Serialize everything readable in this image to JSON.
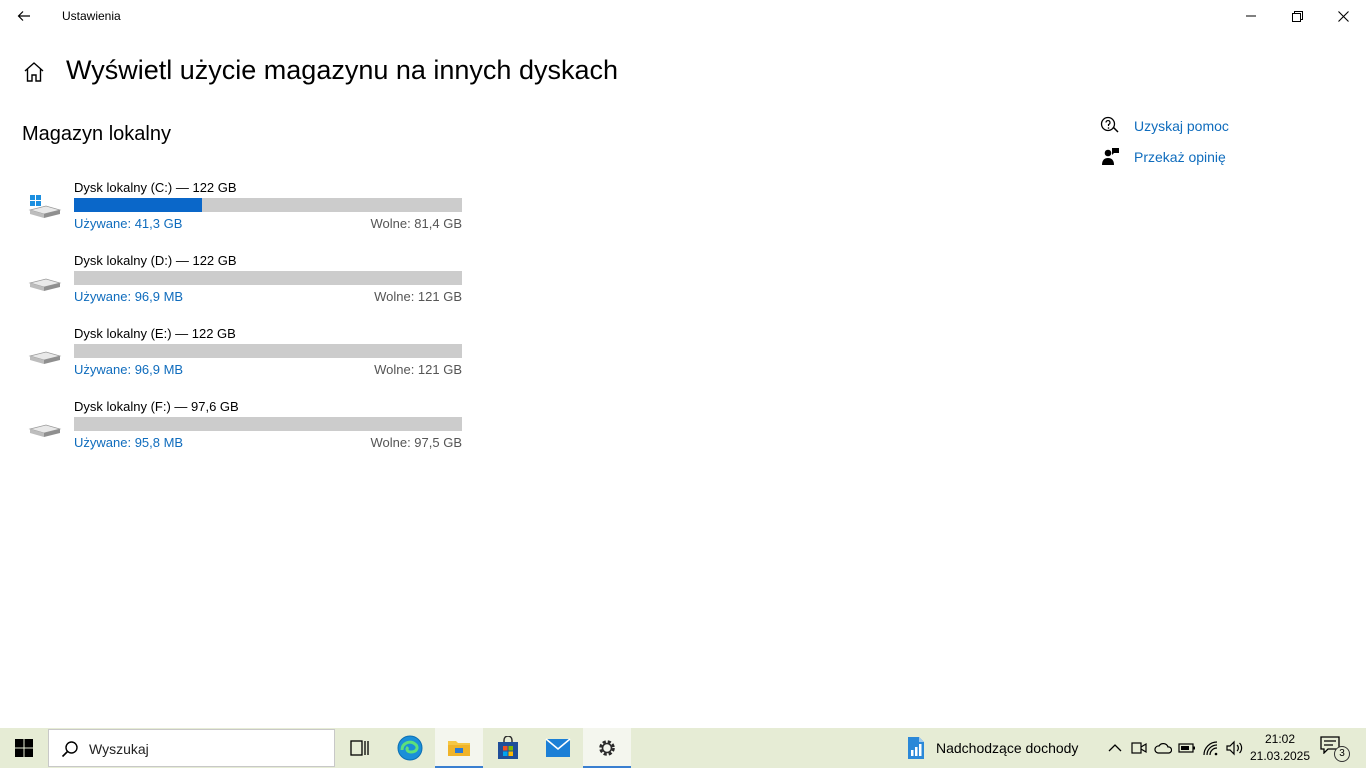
{
  "window": {
    "title": "Ustawienia"
  },
  "page": {
    "title": "Wyświetl użycie magazynu na innych dyskach",
    "section": "Magazyn lokalny"
  },
  "drives": [
    {
      "name": "Dysk lokalny (C:) — 122 GB",
      "used": "Używane: 41,3 GB",
      "free": "Wolne: 81,4 GB",
      "used_fraction": 0.33,
      "system": true
    },
    {
      "name": "Dysk lokalny (D:) — 122 GB",
      "used": "Używane: 96,9 MB",
      "free": "Wolne: 121 GB",
      "used_fraction": 0.0,
      "system": false
    },
    {
      "name": "Dysk lokalny (E:) — 122 GB",
      "used": "Używane: 96,9 MB",
      "free": "Wolne: 121 GB",
      "used_fraction": 0.0,
      "system": false
    },
    {
      "name": "Dysk lokalny (F:) — 97,6 GB",
      "used": "Używane: 95,8 MB",
      "free": "Wolne: 97,5 GB",
      "used_fraction": 0.0,
      "system": false
    }
  ],
  "sidebar": {
    "help": "Uzyskaj pomoc",
    "feedback": "Przekaż opinię"
  },
  "taskbar": {
    "search_placeholder": "Wyszukaj",
    "news": "Nadchodzące dochody",
    "time": "21:02",
    "date": "21.03.2025",
    "notifications": "3"
  },
  "colors": {
    "accent": "#0a67c9",
    "link": "#0f6cbd",
    "bar_track": "#cccccc",
    "taskbar": "#e6ecd5"
  }
}
